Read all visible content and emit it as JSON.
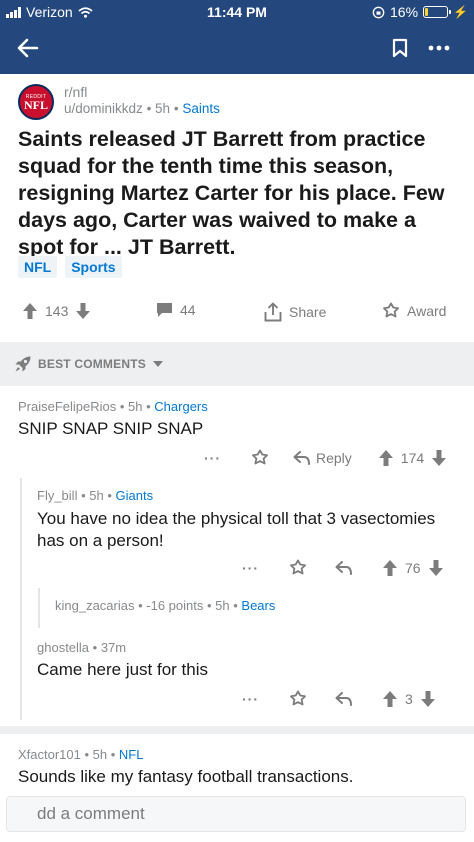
{
  "status_bar": {
    "carrier": "Verizon",
    "time": "11:44 PM",
    "battery": "16%"
  },
  "post": {
    "subreddit": "r/nfl",
    "avatar_top": "REDDIT",
    "avatar_text": "NFL",
    "author": "u/dominikkdz",
    "age": "5h",
    "flair": "Saints",
    "title": "Saints released JT Barrett from practice squad for the tenth time this season, resigning Martez Carter for his place. Few days ago, Carter was waived to make a spot for ... JT Barrett.",
    "tags": [
      "NFL",
      "Sports"
    ],
    "score": "143",
    "comments": "44",
    "share_label": "Share",
    "award_label": "Award"
  },
  "sort_label": "BEST COMMENTS",
  "comments": [
    {
      "author": "PraiseFelipeRios",
      "age": "5h",
      "flair": "Chargers",
      "body": "SNIP SNAP SNIP SNAP",
      "reply_label": "Reply",
      "score": "174"
    },
    {
      "author": "Fly_bill",
      "age": "5h",
      "flair": "Giants",
      "body": "You have no idea the physical toll that 3 vasectomies has on a person!",
      "score": "76"
    },
    {
      "author": "king_zacarias",
      "points": "-16 points",
      "age": "5h",
      "flair": "Bears"
    },
    {
      "author": "ghostella",
      "age": "37m",
      "body": "Came here just for this",
      "score": "3"
    },
    {
      "author": "Xfactor101",
      "age": "5h",
      "flair": "NFL",
      "body": "Sounds like my fantasy football transactions."
    }
  ],
  "composer": {
    "placeholder": "dd a comment"
  },
  "colors": {
    "header": "#24487e",
    "accent": "#0079d3",
    "muted": "#878a8c",
    "divider": "#edeff1"
  },
  "icons": [
    "back-arrow-icon",
    "bookmark-icon",
    "more-icon",
    "upvote-icon",
    "downvote-icon",
    "comment-icon",
    "share-icon",
    "award-icon",
    "rocket-icon",
    "reply-icon",
    "collapse-icon"
  ]
}
